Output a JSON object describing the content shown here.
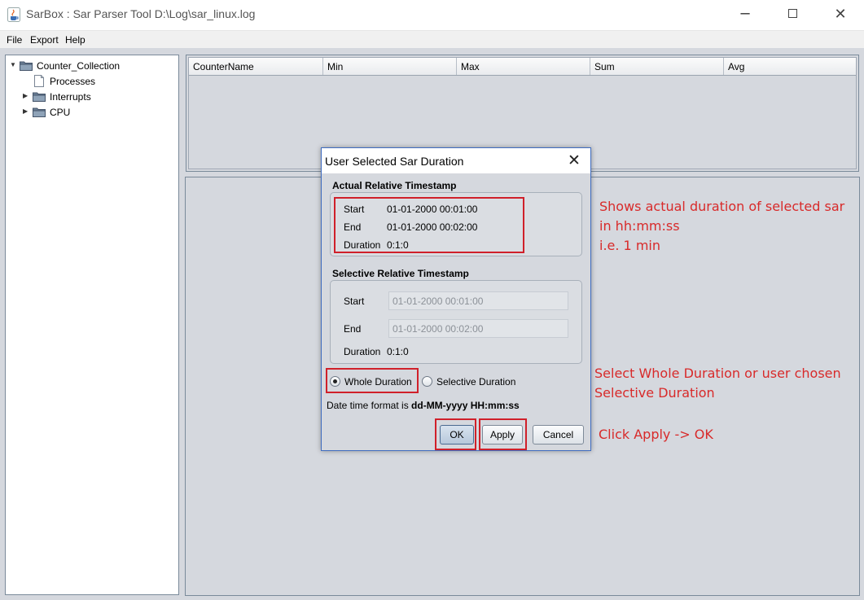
{
  "window": {
    "title": "SarBox : Sar Parser Tool D:\\Log\\sar_linux.log",
    "controls": {
      "minimize": "─",
      "close": "✕"
    }
  },
  "menu": {
    "items": [
      "File",
      "Export",
      "Help"
    ]
  },
  "tree": {
    "root": "Counter_Collection",
    "children": [
      "Processes",
      "Interrupts",
      "CPU"
    ]
  },
  "table": {
    "columns": [
      "CounterName",
      "Min",
      "Max",
      "Sum",
      "Avg"
    ]
  },
  "dialog": {
    "title": "User Selected Sar Duration",
    "close": "✕",
    "actual": {
      "heading": "Actual Relative Timestamp",
      "start_label": "Start",
      "start_value": "01-01-2000 00:01:00",
      "end_label": "End",
      "end_value": "01-01-2000 00:02:00",
      "duration_label": "Duration",
      "duration_value": "0:1:0"
    },
    "selective": {
      "heading": "Selective Relative Timestamp",
      "start_label": "Start",
      "start_value": "01-01-2000 00:01:00",
      "end_label": "End",
      "end_value": "01-01-2000 00:02:00",
      "duration_label": "Duration",
      "duration_value": "0:1:0"
    },
    "radios": {
      "whole": "Whole Duration",
      "selective": "Selective Duration",
      "selected": "whole"
    },
    "format_prefix": "Date time format is ",
    "format_value": "dd-MM-yyyy HH:mm:ss",
    "buttons": {
      "ok": "OK",
      "apply": "Apply",
      "cancel": "Cancel"
    }
  },
  "annotations": {
    "a1": [
      "Shows actual duration of selected sar",
      "in hh:mm:ss",
      "i.e. 1 min"
    ],
    "a2": [
      "Select Whole Duration or user chosen",
      "Selective Duration"
    ],
    "a3": "Click Apply  -> OK",
    "color": "#d82a2a"
  }
}
